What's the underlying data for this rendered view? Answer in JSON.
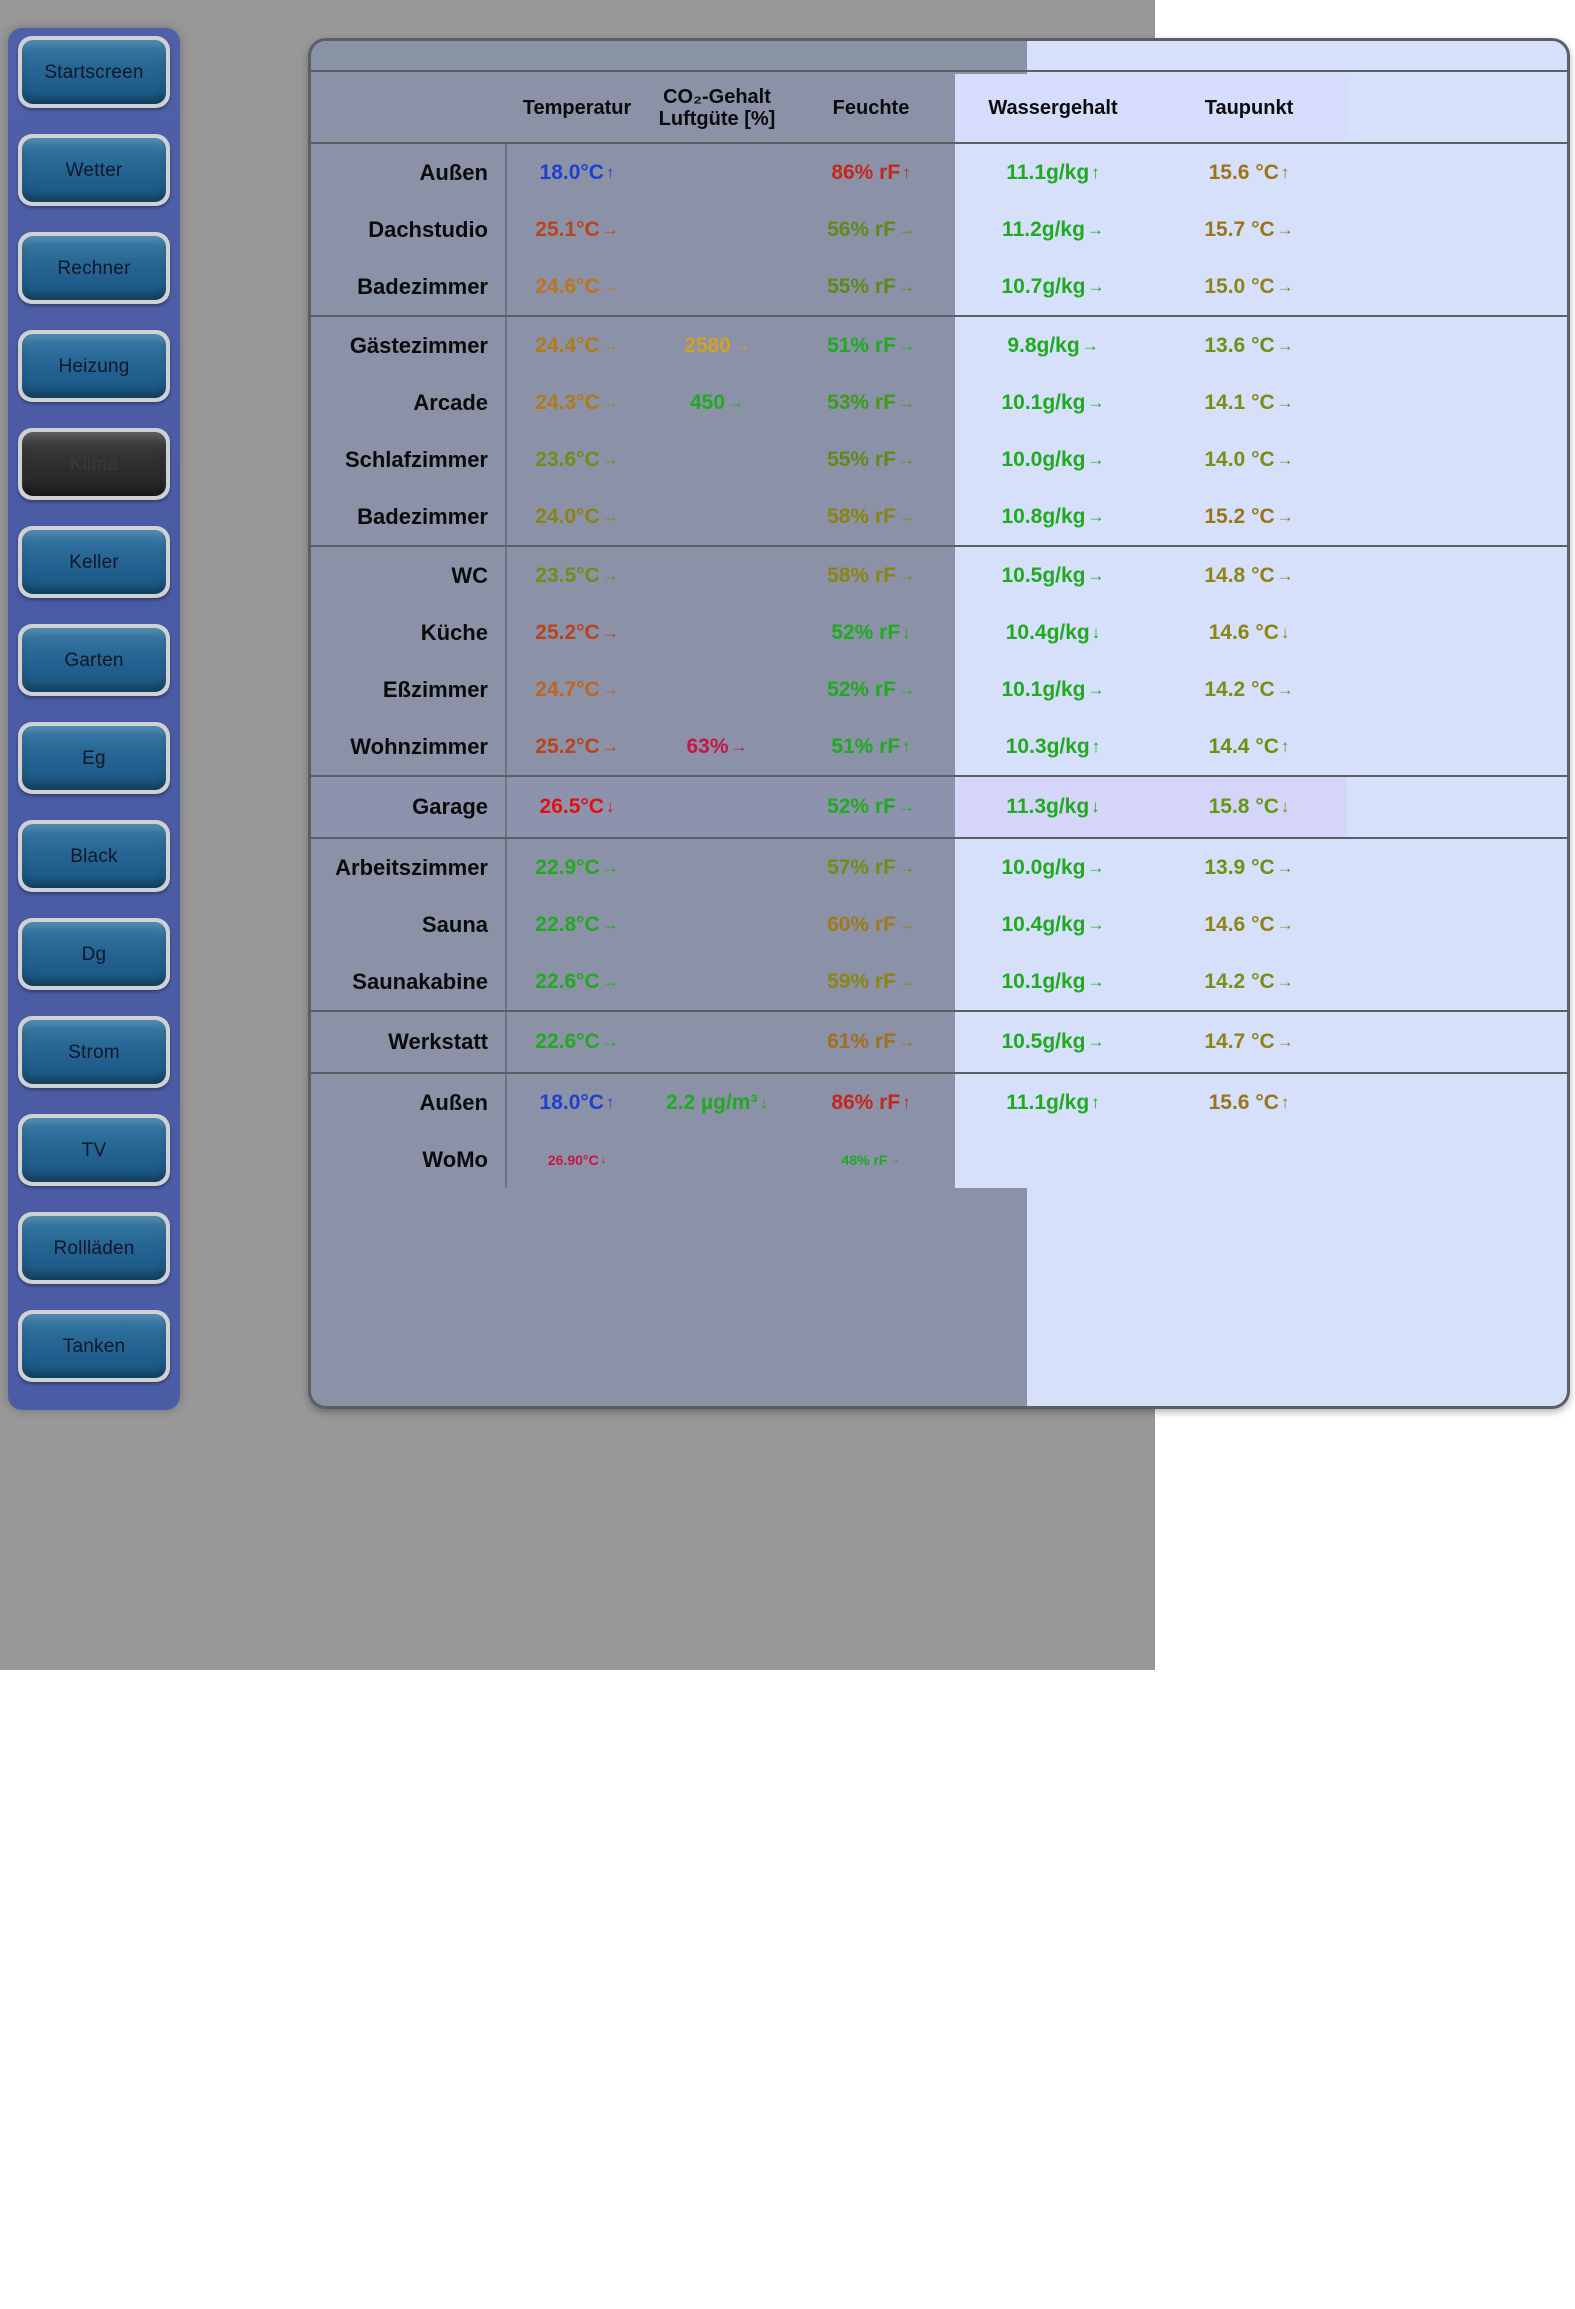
{
  "sidebar": {
    "items": [
      {
        "label": "Startscreen",
        "active": false
      },
      {
        "label": "Wetter",
        "active": false
      },
      {
        "label": "Rechner",
        "active": false
      },
      {
        "label": "Heizung",
        "active": false
      },
      {
        "label": "Klima",
        "active": true
      },
      {
        "label": "Keller",
        "active": false
      },
      {
        "label": "Garten",
        "active": false
      },
      {
        "label": "Eg",
        "active": false
      },
      {
        "label": "Black",
        "active": false
      },
      {
        "label": "Dg",
        "active": false
      },
      {
        "label": "Strom",
        "active": false
      },
      {
        "label": "TV",
        "active": false
      },
      {
        "label": "Rollläden",
        "active": false
      },
      {
        "label": "Tanken",
        "active": false
      }
    ]
  },
  "table": {
    "headers": {
      "room": "",
      "temperature": "Temperatur",
      "co2_line1": "CO₂-Gehalt",
      "co2_line2": "Luftgüte [%]",
      "humidity": "Feuchte",
      "water_content": "Wassergehalt",
      "dew_point": "Taupunkt"
    },
    "colors": {
      "cold_blue": "#1f3fd0",
      "green": "#1faa1f",
      "olive": "#6d8f14",
      "dark_yellow": "#8a8411",
      "amber": "#c08a18",
      "orange": "#c0651b",
      "dark_orange": "#b44a1c",
      "red": "#e11010",
      "dark_red": "#b01414",
      "crimson": "#c4164a",
      "brown": "#8a6a18",
      "panel_grey": "#8b92a8",
      "panel_blue": "#d6e0fb"
    },
    "groups": [
      {
        "rows": [
          {
            "room": "Außen",
            "temp": "18.0°C",
            "temp_arrow": "↑",
            "temp_color": "#1f3fd0",
            "co2": "",
            "co2_arrow": "",
            "co2_color": "",
            "hum": "86% rF",
            "hum_arrow": "↑",
            "hum_color": "#c2281b",
            "water": "11.1g/kg",
            "water_arrow": "↑",
            "water_color": "#1faa1f",
            "dew": "15.6 °C",
            "dew_arrow": "↑",
            "dew_color": "#9a7518"
          },
          {
            "room": "Dachstudio",
            "temp": "25.1°C",
            "temp_arrow": "→",
            "temp_color": "#b8441c",
            "co2": "",
            "co2_arrow": "",
            "co2_color": "",
            "hum": "56% rF",
            "hum_arrow": "→",
            "hum_color": "#5f8a18",
            "water": "11.2g/kg",
            "water_arrow": "→",
            "water_color": "#1faa1f",
            "dew": "15.7 °C",
            "dew_arrow": "→",
            "dew_color": "#9a7518"
          },
          {
            "room": "Badezimmer",
            "temp": "24.6°C",
            "temp_arrow": "→",
            "temp_color": "#c0741a",
            "co2": "",
            "co2_arrow": "",
            "co2_color": "",
            "hum": "55% rF",
            "hum_arrow": "→",
            "hum_color": "#5f8a18",
            "water": "10.7g/kg",
            "water_arrow": "→",
            "water_color": "#1faa1f",
            "dew": "15.0 °C",
            "dew_arrow": "→",
            "dew_color": "#8d8414"
          }
        ]
      },
      {
        "rows": [
          {
            "room": "Gästezimmer",
            "temp": "24.4°C",
            "temp_arrow": "→",
            "temp_color": "#b07a18",
            "co2": "2580",
            "co2_arrow": "→",
            "co2_color": "#d1a02a",
            "hum": "51% rF",
            "hum_arrow": "→",
            "hum_color": "#1faa1f",
            "water": "9.8g/kg",
            "water_arrow": "→",
            "water_color": "#1faa1f",
            "dew": "13.6 °C",
            "dew_arrow": "→",
            "dew_color": "#6d8f14"
          },
          {
            "room": "Arcade",
            "temp": "24.3°C",
            "temp_arrow": "→",
            "temp_color": "#b07a18",
            "co2": "450",
            "co2_arrow": "→",
            "co2_color": "#1faa1f",
            "hum": "53% rF",
            "hum_arrow": "→",
            "hum_color": "#3f9a1a",
            "water": "10.1g/kg",
            "water_arrow": "→",
            "water_color": "#1faa1f",
            "dew": "14.1 °C",
            "dew_arrow": "→",
            "dew_color": "#7d8c14"
          },
          {
            "room": "Schlafzimmer",
            "temp": "23.6°C",
            "temp_arrow": "→",
            "temp_color": "#6d8f14",
            "co2": "",
            "co2_arrow": "",
            "co2_color": "",
            "hum": "55% rF",
            "hum_arrow": "→",
            "hum_color": "#5f8a18",
            "water": "10.0g/kg",
            "water_arrow": "→",
            "water_color": "#1faa1f",
            "dew": "14.0 °C",
            "dew_arrow": "→",
            "dew_color": "#7d8c14"
          },
          {
            "room": "Badezimmer",
            "temp": "24.0°C",
            "temp_arrow": "→",
            "temp_color": "#8a8411",
            "co2": "",
            "co2_arrow": "",
            "co2_color": "",
            "hum": "58% rF",
            "hum_arrow": "→",
            "hum_color": "#8a8411",
            "water": "10.8g/kg",
            "water_arrow": "→",
            "water_color": "#1faa1f",
            "dew": "15.2 °C",
            "dew_arrow": "→",
            "dew_color": "#9a7518"
          }
        ]
      },
      {
        "rows": [
          {
            "room": "WC",
            "temp": "23.5°C",
            "temp_arrow": "→",
            "temp_color": "#6d8f14",
            "co2": "",
            "co2_arrow": "",
            "co2_color": "",
            "hum": "58% rF",
            "hum_arrow": "→",
            "hum_color": "#8a8411",
            "water": "10.5g/kg",
            "water_arrow": "→",
            "water_color": "#1faa1f",
            "dew": "14.8 °C",
            "dew_arrow": "→",
            "dew_color": "#8d8414"
          },
          {
            "room": "Küche",
            "temp": "25.2°C",
            "temp_arrow": "→",
            "temp_color": "#b8441c",
            "co2": "",
            "co2_arrow": "",
            "co2_color": "",
            "hum": "52% rF",
            "hum_arrow": "↓",
            "hum_color": "#1faa1f",
            "water": "10.4g/kg",
            "water_arrow": "↓",
            "water_color": "#1faa1f",
            "dew": "14.6 °C",
            "dew_arrow": "↓",
            "dew_color": "#8d8414"
          },
          {
            "room": "Eßzimmer",
            "temp": "24.7°C",
            "temp_arrow": "→",
            "temp_color": "#c0651b",
            "co2": "",
            "co2_arrow": "",
            "co2_color": "",
            "hum": "52% rF",
            "hum_arrow": "→",
            "hum_color": "#1faa1f",
            "water": "10.1g/kg",
            "water_arrow": "→",
            "water_color": "#1faa1f",
            "dew": "14.2 °C",
            "dew_arrow": "→",
            "dew_color": "#7d8c14"
          },
          {
            "room": "Wohnzimmer",
            "temp": "25.2°C",
            "temp_arrow": "→",
            "temp_color": "#b8441c",
            "co2": "63%",
            "co2_arrow": "→",
            "co2_color": "#c4164a",
            "hum": "51% rF",
            "hum_arrow": "↑",
            "hum_color": "#1faa1f",
            "water": "10.3g/kg",
            "water_arrow": "↑",
            "water_color": "#1faa1f",
            "dew": "14.4 °C",
            "dew_arrow": "↑",
            "dew_color": "#6d8f14"
          }
        ]
      },
      {
        "highlight": true,
        "rows": [
          {
            "room": "Garage",
            "temp": "26.5°C",
            "temp_arrow": "↓",
            "temp_color": "#e11010",
            "co2": "",
            "co2_arrow": "",
            "co2_color": "",
            "hum": "52% rF",
            "hum_arrow": "→",
            "hum_color": "#1faa1f",
            "water": "11.3g/kg",
            "water_arrow": "↓",
            "water_color": "#1faa1f",
            "dew": "15.8 °C",
            "dew_arrow": "↓",
            "dew_color": "#5f9a14"
          }
        ]
      },
      {
        "rows": [
          {
            "room": "Arbeitszimmer",
            "temp": "22.9°C",
            "temp_arrow": "→",
            "temp_color": "#1faa1f",
            "co2": "",
            "co2_arrow": "",
            "co2_color": "",
            "hum": "57% rF",
            "hum_arrow": "→",
            "hum_color": "#6d8f14",
            "water": "10.0g/kg",
            "water_arrow": "→",
            "water_color": "#1faa1f",
            "dew": "13.9 °C",
            "dew_arrow": "→",
            "dew_color": "#6d8f14"
          },
          {
            "room": "Sauna",
            "temp": "22.8°C",
            "temp_arrow": "→",
            "temp_color": "#1faa1f",
            "co2": "",
            "co2_arrow": "",
            "co2_color": "",
            "hum": "60% rF",
            "hum_arrow": "→",
            "hum_color": "#a07a18",
            "water": "10.4g/kg",
            "water_arrow": "→",
            "water_color": "#1faa1f",
            "dew": "14.6 °C",
            "dew_arrow": "→",
            "dew_color": "#8d8414"
          },
          {
            "room": "Saunakabine",
            "temp": "22.6°C",
            "temp_arrow": "→",
            "temp_color": "#1faa1f",
            "co2": "",
            "co2_arrow": "",
            "co2_color": "",
            "hum": "59% rF",
            "hum_arrow": "→",
            "hum_color": "#8a8411",
            "water": "10.1g/kg",
            "water_arrow": "→",
            "water_color": "#1faa1f",
            "dew": "14.2 °C",
            "dew_arrow": "→",
            "dew_color": "#7d8c14"
          }
        ]
      },
      {
        "rows": [
          {
            "room": "Werkstatt",
            "temp": "22.6°C",
            "temp_arrow": "→",
            "temp_color": "#1faa1f",
            "co2": "",
            "co2_arrow": "",
            "co2_color": "",
            "hum": "61% rF",
            "hum_arrow": "→",
            "hum_color": "#a0701a",
            "water": "10.5g/kg",
            "water_arrow": "→",
            "water_color": "#1faa1f",
            "dew": "14.7 °C",
            "dew_arrow": "→",
            "dew_color": "#8d8414"
          }
        ]
      },
      {
        "rows": [
          {
            "room": "Außen",
            "temp": "18.0°C",
            "temp_arrow": "↑",
            "temp_color": "#1f3fd0",
            "co2": "2.2 µg/m³",
            "co2_arrow": "↓",
            "co2_color": "#1faa1f",
            "hum": "86% rF",
            "hum_arrow": "↑",
            "hum_color": "#c2281b",
            "water": "11.1g/kg",
            "water_arrow": "↑",
            "water_color": "#1faa1f",
            "dew": "15.6 °C",
            "dew_arrow": "↑",
            "dew_color": "#9a7518"
          },
          {
            "room": "WoMo",
            "small": true,
            "temp": "26.90°C",
            "temp_arrow": "↓",
            "temp_color": "#c4164a",
            "co2": "",
            "co2_arrow": "",
            "co2_color": "",
            "hum": "48% rF",
            "hum_arrow": "→",
            "hum_color": "#1faa1f",
            "water": "",
            "water_arrow": "",
            "water_color": "",
            "dew": "",
            "dew_arrow": "",
            "dew_color": ""
          }
        ]
      }
    ]
  }
}
